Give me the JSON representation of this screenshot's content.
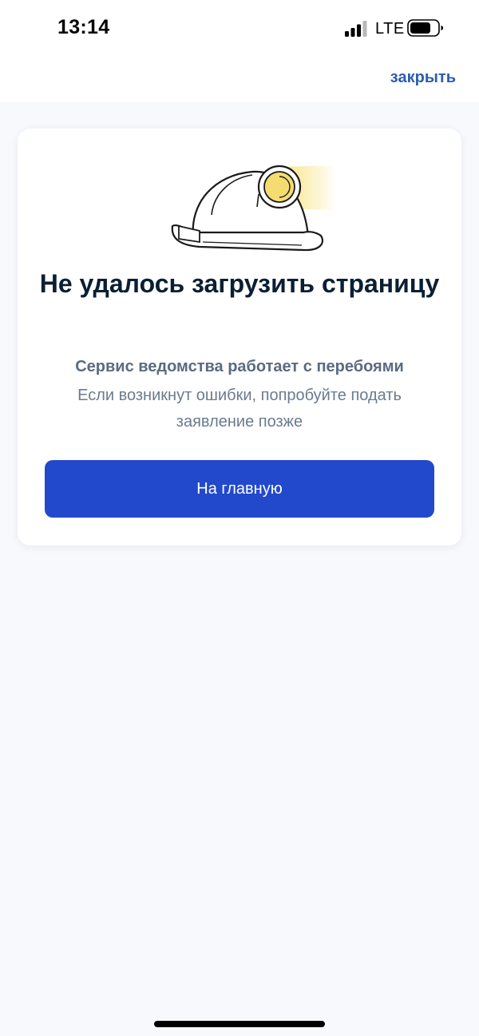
{
  "status_bar": {
    "time": "13:14",
    "network": "LTE",
    "icons": [
      "signal-icon",
      "battery-icon"
    ]
  },
  "nav": {
    "close_label": "закрыть"
  },
  "error_card": {
    "illustration": "mining-helmet-with-headlamp",
    "title": "Не удалось загрузить страницу",
    "subtitle": "Сервис ведомства работает с перебоями",
    "description": "Если возникнут ошибки, попробуйте подать заявление позже",
    "button_label": "На главную"
  },
  "colors": {
    "accent": "#2249cc",
    "link": "#2d5dad",
    "title": "#0b1f33",
    "text_secondary": "#6a7b90",
    "background": "#f8f9fc",
    "lamp": "#f5dc70"
  }
}
